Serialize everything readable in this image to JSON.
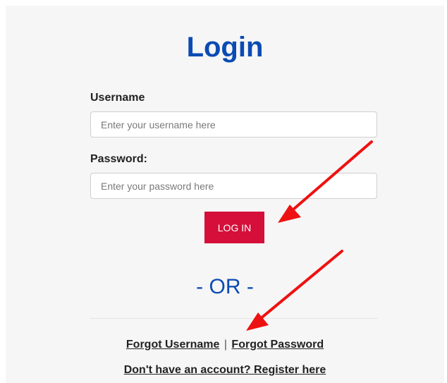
{
  "title": "Login",
  "form": {
    "username_label": "Username",
    "username_placeholder": "Enter your username here",
    "username_value": "",
    "password_label": "Password:",
    "password_placeholder": "Enter your password here",
    "password_value": "",
    "login_button": "LOG IN"
  },
  "divider_text": "- OR -",
  "links": {
    "forgot_username": "Forgot Username",
    "separator": "|",
    "forgot_password": "Forgot Password",
    "register": "Don't have an account? Register here"
  },
  "colors": {
    "title": "#0b4bb3",
    "button": "#d50f3a",
    "arrow": "#ee1111",
    "panel": "#f6f6f6"
  }
}
